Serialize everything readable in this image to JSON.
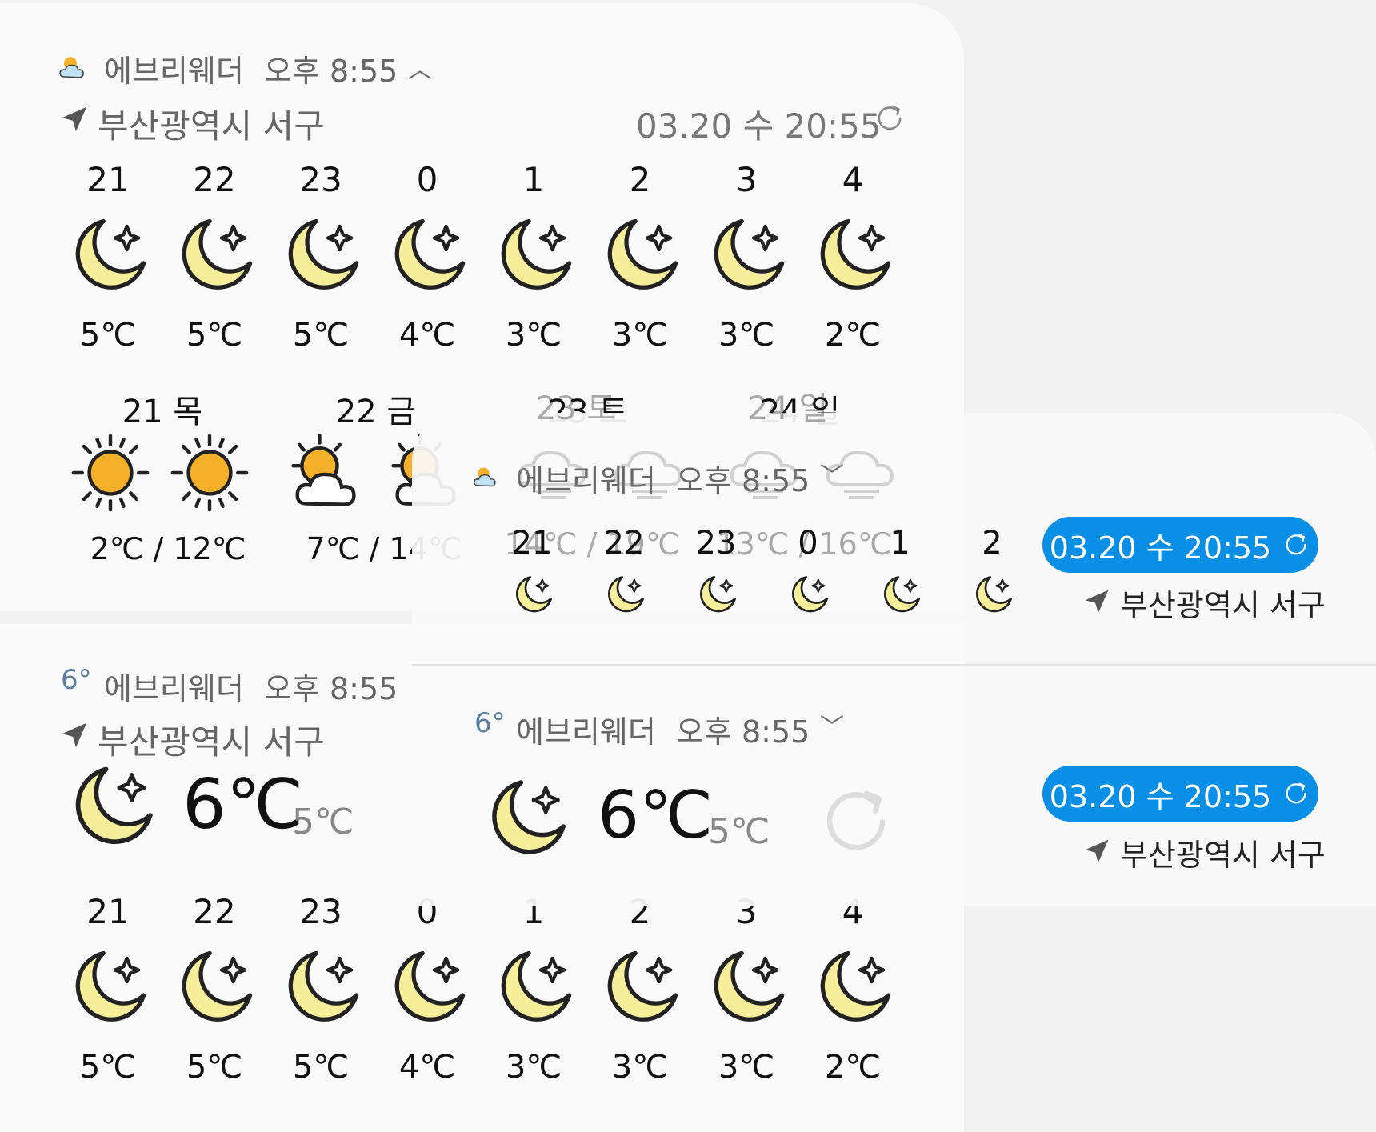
{
  "app_name": "에브리웨더",
  "notif_time": "오후 8:55",
  "location": "부산광역시 서구",
  "updated": "03.20 수 20:55",
  "current": {
    "temp": "6℃",
    "feels": "5℃",
    "badge": "6°"
  },
  "hourly": [
    {
      "hour": "21",
      "temp": "5℃",
      "icon": "moon-star"
    },
    {
      "hour": "22",
      "temp": "5℃",
      "icon": "moon-star"
    },
    {
      "hour": "23",
      "temp": "5℃",
      "icon": "moon-star"
    },
    {
      "hour": "0",
      "temp": "4℃",
      "icon": "moon-star"
    },
    {
      "hour": "1",
      "temp": "3℃",
      "icon": "moon-star"
    },
    {
      "hour": "2",
      "temp": "3℃",
      "icon": "moon-star"
    },
    {
      "hour": "3",
      "temp": "3℃",
      "icon": "moon-star"
    },
    {
      "hour": "4",
      "temp": "2℃",
      "icon": "moon-star"
    }
  ],
  "daily": [
    {
      "day": "21 목",
      "range": "2℃ / 12℃",
      "icons": [
        "sun",
        "sun"
      ]
    },
    {
      "day": "22 금",
      "range": "7℃ / 14℃",
      "icons": [
        "partly-cloudy",
        "partly-cloudy"
      ]
    },
    {
      "day": "23 토",
      "range": "14℃ / 19℃",
      "icons": [
        "cloud",
        "cloud"
      ]
    },
    {
      "day": "24 일",
      "range": "13℃ / 16℃",
      "icons": [
        "cloud-rain",
        "cloud"
      ]
    }
  ],
  "colors": {
    "accent": "#0a8fe6",
    "moon": "#f6ee9a",
    "sun": "#f5b02a"
  }
}
